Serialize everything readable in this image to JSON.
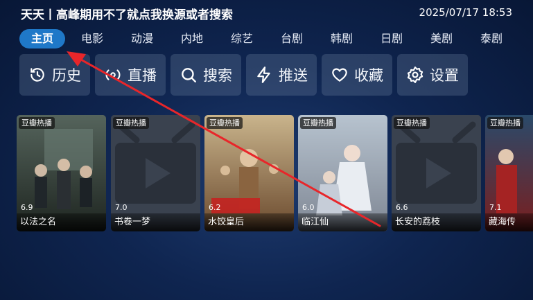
{
  "header": {
    "title": "天天丨高峰期用不了就点我换源或者搜索",
    "datetime": "2025/07/17 18:53"
  },
  "tabs": [
    {
      "label": "主页",
      "active": true
    },
    {
      "label": "电影"
    },
    {
      "label": "动漫"
    },
    {
      "label": "内地"
    },
    {
      "label": "综艺"
    },
    {
      "label": "台剧"
    },
    {
      "label": "韩剧"
    },
    {
      "label": "日剧"
    },
    {
      "label": "美剧"
    },
    {
      "label": "泰剧"
    }
  ],
  "actions": [
    {
      "label": "历史",
      "icon": "history-icon"
    },
    {
      "label": "直播",
      "icon": "live-icon"
    },
    {
      "label": "搜索",
      "icon": "search-icon"
    },
    {
      "label": "推送",
      "icon": "lightning-icon"
    },
    {
      "label": "收藏",
      "icon": "heart-icon"
    },
    {
      "label": "设置",
      "icon": "gear-icon"
    }
  ],
  "cards": [
    {
      "badge": "豆瓣热播",
      "rating": "6.9",
      "title": "以法之名"
    },
    {
      "badge": "豆瓣热播",
      "rating": "7.0",
      "title": "书卷一梦"
    },
    {
      "badge": "豆瓣热播",
      "rating": "6.2",
      "title": "水饺皇后"
    },
    {
      "badge": "豆瓣热播",
      "rating": "6.0",
      "title": "临江仙"
    },
    {
      "badge": "豆瓣热播",
      "rating": "6.6",
      "title": "长安的荔枝"
    },
    {
      "badge": "豆瓣热播",
      "rating": "7.1",
      "title": "藏海传"
    }
  ],
  "colors": {
    "accent": "#1f78c8",
    "annotation_arrow": "#e8262a"
  }
}
